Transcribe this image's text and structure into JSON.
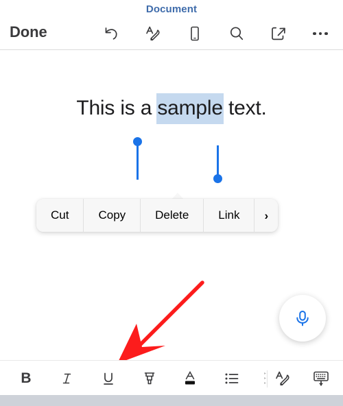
{
  "header": {
    "title": "Document",
    "done_label": "Done",
    "title_color": "#3f6cab",
    "icons": [
      {
        "name": "undo-icon",
        "label": "Undo"
      },
      {
        "name": "markup-pen-icon",
        "label": "Markup"
      },
      {
        "name": "phone-layout-icon",
        "label": "Phone Layout"
      },
      {
        "name": "search-icon",
        "label": "Search"
      },
      {
        "name": "share-icon",
        "label": "Share"
      },
      {
        "name": "more-options-icon",
        "label": "More"
      }
    ]
  },
  "document": {
    "text_before": "This is a ",
    "selected_text": "sample",
    "text_after": " text.",
    "full_text": "This is a sample text.",
    "selection_color": "#c5d9ef",
    "handle_color": "#1a73e8"
  },
  "context_menu": {
    "items": [
      {
        "label": "Cut",
        "name": "menu-item-cut"
      },
      {
        "label": "Copy",
        "name": "menu-item-copy"
      },
      {
        "label": "Delete",
        "name": "menu-item-delete"
      },
      {
        "label": "Link",
        "name": "menu-item-link"
      }
    ],
    "more_chevron": "›"
  },
  "annotation": {
    "arrow_color": "#fc1c1c",
    "points_to": "underline-button"
  },
  "dictation": {
    "icon": "microphone-icon",
    "icon_color": "#1a73e8"
  },
  "format_bar": {
    "bold_label": "B",
    "italic_label": "I",
    "underline_label": "U",
    "textcolor_label": "A",
    "scroll_hint": "▸▸▸",
    "items": [
      {
        "name": "bold-button",
        "label": "Bold"
      },
      {
        "name": "italic-button",
        "label": "Italic"
      },
      {
        "name": "underline-button",
        "label": "Underline"
      },
      {
        "name": "highlighter-button",
        "label": "Highlight"
      },
      {
        "name": "text-color-button",
        "label": "Text Color"
      },
      {
        "name": "bullet-list-button",
        "label": "Bullet List"
      },
      {
        "name": "markup-pen-button",
        "label": "Markup"
      },
      {
        "name": "hide-keyboard-button",
        "label": "Hide Keyboard"
      }
    ]
  },
  "home_indicator_color": "#ced2d9"
}
